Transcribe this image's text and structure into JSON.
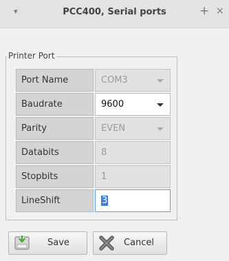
{
  "window": {
    "title": "PCC400, Serial ports",
    "menu_glyph": "▾",
    "add_glyph": "+",
    "close_glyph": "×"
  },
  "printer_port": {
    "group_label": "Printer Port",
    "port_name": {
      "label": "Port Name",
      "value": "COM3",
      "enabled": false
    },
    "baudrate": {
      "label": "Baudrate",
      "value": "9600",
      "enabled": true
    },
    "parity": {
      "label": "Parity",
      "value": "EVEN",
      "enabled": false
    },
    "databits": {
      "label": "Databits",
      "value": "8",
      "enabled": false
    },
    "stopbits": {
      "label": "Stopbits",
      "value": "1",
      "enabled": false
    },
    "lineshift": {
      "label": "LineShift",
      "value": "3",
      "enabled": true,
      "focused": true
    }
  },
  "buttons": {
    "save_label": "Save",
    "cancel_label": "Cancel"
  },
  "icons": {
    "save": "save-disk-icon",
    "cancel": "cancel-x-icon"
  },
  "colors": {
    "focus_border": "#5aa0e6",
    "selection": "#3d7fd9"
  }
}
